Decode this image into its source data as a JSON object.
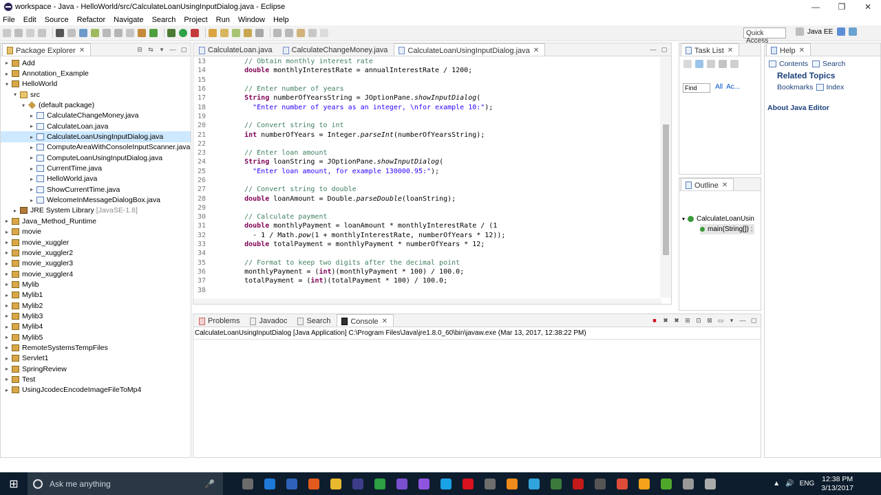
{
  "window": {
    "title": "workspace - Java - HelloWorld/src/CalculateLoanUsingInputDialog.java - Eclipse",
    "controls": [
      "—",
      "❐",
      "✕"
    ]
  },
  "menu": [
    "File",
    "Edit",
    "Source",
    "Refactor",
    "Navigate",
    "Search",
    "Project",
    "Run",
    "Window",
    "Help"
  ],
  "toolbar": {
    "quick_access": "Quick Access",
    "perspective": "Java EE"
  },
  "package_explorer": {
    "tab": "Package Explorer",
    "items": [
      {
        "label": "Add",
        "level": 0,
        "type": "proj",
        "twisty": "▸"
      },
      {
        "label": "Annotation_Example",
        "level": 0,
        "type": "proj",
        "twisty": "▸"
      },
      {
        "label": "HelloWorld",
        "level": 0,
        "type": "proj",
        "twisty": "▾"
      },
      {
        "label": "src",
        "level": 1,
        "type": "folder",
        "twisty": "▾"
      },
      {
        "label": "(default package)",
        "level": 2,
        "type": "pkgi",
        "twisty": "▾"
      },
      {
        "label": "CalculateChangeMoney.java",
        "level": 3,
        "type": "java",
        "twisty": "▸"
      },
      {
        "label": "CalculateLoan.java",
        "level": 3,
        "type": "java",
        "twisty": "▸"
      },
      {
        "label": "CalculateLoanUsingInputDialog.java",
        "level": 3,
        "type": "java",
        "twisty": "▸",
        "selected": true
      },
      {
        "label": "ComputeAreaWithConsoleInputScanner.java",
        "level": 3,
        "type": "java",
        "twisty": "▸"
      },
      {
        "label": "ComputeLoanUsingInputDialog.java",
        "level": 3,
        "type": "java",
        "twisty": "▸"
      },
      {
        "label": "CurrentTime.java",
        "level": 3,
        "type": "java",
        "twisty": "▸"
      },
      {
        "label": "HelloWorld.java",
        "level": 3,
        "type": "java",
        "twisty": "▸"
      },
      {
        "label": "ShowCurrentTime.java",
        "level": 3,
        "type": "java",
        "twisty": "▸"
      },
      {
        "label": "WelcomeInMessageDialogBox.java",
        "level": 3,
        "type": "java",
        "twisty": "▸"
      },
      {
        "label": "JRE System Library",
        "level": 1,
        "type": "lib",
        "twisty": "▸",
        "suffix": "[JavaSE-1.8]"
      },
      {
        "label": "Java_Method_Runtime",
        "level": 0,
        "type": "proj",
        "twisty": "▸"
      },
      {
        "label": "movie",
        "level": 0,
        "type": "proj",
        "twisty": "▸"
      },
      {
        "label": "movie_xuggler",
        "level": 0,
        "type": "proj",
        "twisty": "▸"
      },
      {
        "label": "movie_xuggler2",
        "level": 0,
        "type": "proj",
        "twisty": "▸"
      },
      {
        "label": "movie_xuggler3",
        "level": 0,
        "type": "proj",
        "twisty": "▸"
      },
      {
        "label": "movie_xuggler4",
        "level": 0,
        "type": "proj",
        "twisty": "▸"
      },
      {
        "label": "Mylib",
        "level": 0,
        "type": "proj",
        "twisty": "▸"
      },
      {
        "label": "Mylib1",
        "level": 0,
        "type": "proj",
        "twisty": "▸"
      },
      {
        "label": "Mylib2",
        "level": 0,
        "type": "proj",
        "twisty": "▸"
      },
      {
        "label": "Mylib3",
        "level": 0,
        "type": "proj",
        "twisty": "▸"
      },
      {
        "label": "Mylib4",
        "level": 0,
        "type": "proj",
        "twisty": "▸"
      },
      {
        "label": "Mylib5",
        "level": 0,
        "type": "proj",
        "twisty": "▸"
      },
      {
        "label": "RemoteSystemsTempFiles",
        "level": 0,
        "type": "proj",
        "twisty": "▸"
      },
      {
        "label": "Servlet1",
        "level": 0,
        "type": "proj",
        "twisty": "▸"
      },
      {
        "label": "SpringReview",
        "level": 0,
        "type": "proj",
        "twisty": "▸"
      },
      {
        "label": "Test",
        "level": 0,
        "type": "proj",
        "twisty": "▸"
      },
      {
        "label": "UsingJcodecEncodeImageFileToMp4",
        "level": 0,
        "type": "proj",
        "twisty": "▸"
      }
    ]
  },
  "editor": {
    "tabs": [
      {
        "label": "CalculateLoan.java",
        "active": false
      },
      {
        "label": "CalculateChangeMoney.java",
        "active": false
      },
      {
        "label": "CalculateLoanUsingInputDialog.java",
        "active": true
      }
    ],
    "lines": [
      {
        "n": "13",
        "code": "    // Obtain monthly interest rate"
      },
      {
        "n": "14",
        "code": "    double monthlyInterestRate = annualInterestRate / 1200;"
      },
      {
        "n": "15",
        "code": ""
      },
      {
        "n": "16",
        "code": "    // Enter number of years"
      },
      {
        "n": "17",
        "code": "    String numberOfYearsString = JOptionPane.showInputDialog("
      },
      {
        "n": "18",
        "code": "      \"Enter number of years as an integer, \\nfor example 10:\");"
      },
      {
        "n": "19",
        "code": ""
      },
      {
        "n": "20",
        "code": "    // Convert string to int"
      },
      {
        "n": "21",
        "code": "    int numberOfYears = Integer.parseInt(numberOfYearsString);"
      },
      {
        "n": "22",
        "code": ""
      },
      {
        "n": "23",
        "code": "    // Enter loan amount"
      },
      {
        "n": "24",
        "code": "    String loanString = JOptionPane.showInputDialog("
      },
      {
        "n": "25",
        "code": "      \"Enter loan amount, for example 130000.95:\");"
      },
      {
        "n": "26",
        "code": ""
      },
      {
        "n": "27",
        "code": "    // Convert string to double"
      },
      {
        "n": "28",
        "code": "    double loanAmount = Double.parseDouble(loanString);"
      },
      {
        "n": "29",
        "code": ""
      },
      {
        "n": "30",
        "code": "    // Calculate payment"
      },
      {
        "n": "31",
        "code": "    double monthlyPayment = loanAmount * monthlyInterestRate / (1"
      },
      {
        "n": "32",
        "code": "      - 1 / Math.pow(1 + monthlyInterestRate, numberOfYears * 12));"
      },
      {
        "n": "33",
        "code": "    double totalPayment = monthlyPayment * numberOfYears * 12;"
      },
      {
        "n": "34",
        "code": ""
      },
      {
        "n": "35",
        "code": "    // Format to keep two digits after the decimal point"
      },
      {
        "n": "36",
        "code": "    monthlyPayment = (int)(monthlyPayment * 100) / 100.0;"
      },
      {
        "n": "37",
        "code": "    totalPayment = (int)(totalPayment * 100) / 100.0;"
      },
      {
        "n": "38",
        "code": ""
      }
    ]
  },
  "console": {
    "tabs": [
      {
        "label": "Problems",
        "active": false
      },
      {
        "label": "Javadoc",
        "active": false
      },
      {
        "label": "Search",
        "active": false
      },
      {
        "label": "Console",
        "active": true
      }
    ],
    "description": "CalculateLoanUsingInputDialog [Java Application] C:\\Program Files\\Java\\jre1.8.0_60\\bin\\javaw.exe (Mar 13, 2017, 12:38:22 PM)"
  },
  "task_list": {
    "tab": "Task List",
    "find_placeholder": "Find",
    "all": "All",
    "activate": "Ac..."
  },
  "outline": {
    "tab": "Outline",
    "class_label": "CalculateLoanUsin",
    "method_label": "main(String[]) :"
  },
  "help": {
    "tab": "Help",
    "contents": "Contents",
    "search": "Search",
    "related": "Related Topics",
    "bookmarks": "Bookmarks",
    "index": "Index",
    "about": "About Java Editor"
  },
  "taskbar": {
    "search_placeholder": "Ask me anything",
    "language": "ENG",
    "time": "12:38 PM",
    "date": "3/13/2017",
    "app_colors": [
      "#6b6b6b",
      "#1e78d7",
      "#2d62b8",
      "#e25a1c",
      "#e8b92e",
      "#3c3c8a",
      "#2ca042",
      "#7a4fd0",
      "#8e54e0",
      "#1aa1e6",
      "#d8121e",
      "#6e6e6e",
      "#f08a1a",
      "#2fa3dc",
      "#3b7a3b",
      "#c41a1a",
      "#555555",
      "#dd4b39",
      "#f4a31a",
      "#4fa82a",
      "#999999",
      "#aaaaaa"
    ]
  }
}
